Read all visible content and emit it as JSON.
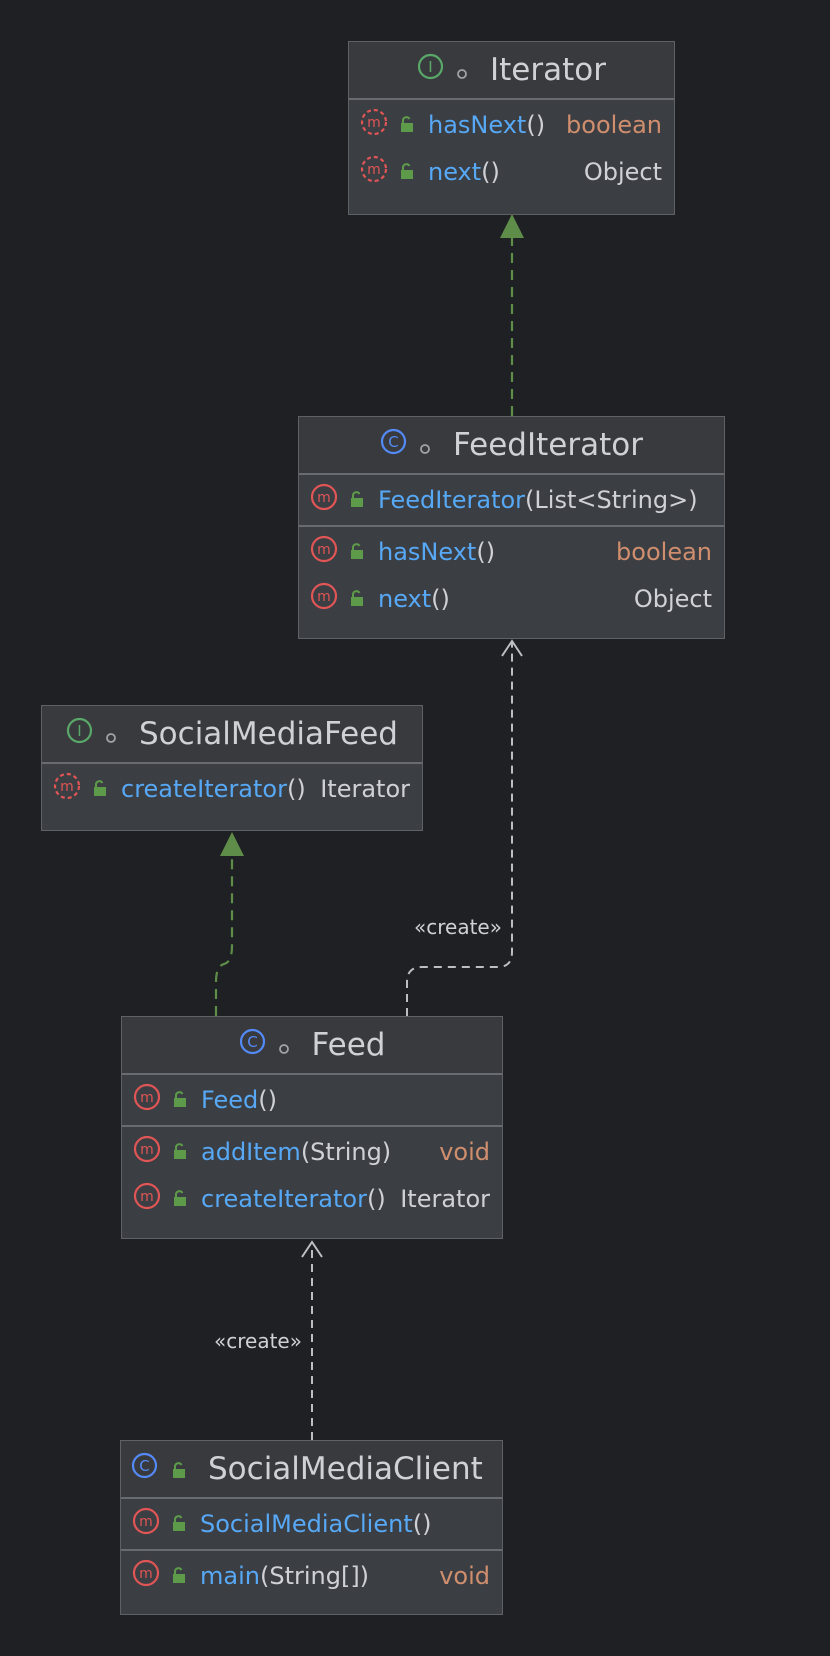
{
  "colors": {
    "background": "#1f2023",
    "box": "#3b3e43",
    "header": "#393a3d",
    "method_name": "#57a8f5",
    "primitive_type": "#cf8e6d",
    "realization_edge": "#5d8d49",
    "dependency_edge": "#bcbec4",
    "interface_icon": "#59a869",
    "class_icon": "#548af7",
    "method_icon": "#e05555"
  },
  "boxes": {
    "iterator": {
      "name": "Iterator",
      "kind": "interface",
      "kind_letter": "I",
      "methods": [
        {
          "name": "hasNext",
          "params": "()",
          "type": "boolean",
          "abstract": true,
          "primitive": true
        },
        {
          "name": "next",
          "params": "()",
          "type": "Object",
          "abstract": true,
          "primitive": false
        }
      ]
    },
    "feed_iterator": {
      "name": "FeedIterator",
      "kind": "class",
      "kind_letter": "C",
      "constructors": [
        {
          "name": "FeedIterator",
          "params": "(List<String>)"
        }
      ],
      "methods": [
        {
          "name": "hasNext",
          "params": "()",
          "type": "boolean",
          "primitive": true
        },
        {
          "name": "next",
          "params": "()",
          "type": "Object",
          "primitive": false
        }
      ]
    },
    "social_media_feed": {
      "name": "SocialMediaFeed",
      "kind": "interface",
      "kind_letter": "I",
      "methods": [
        {
          "name": "createIterator",
          "params": "()",
          "type": "Iterator",
          "abstract": true,
          "primitive": false
        }
      ]
    },
    "feed": {
      "name": "Feed",
      "kind": "class",
      "kind_letter": "C",
      "constructors": [
        {
          "name": "Feed",
          "params": "()"
        }
      ],
      "methods": [
        {
          "name": "addItem",
          "params": "(String)",
          "type": "void",
          "primitive": true
        },
        {
          "name": "createIterator",
          "params": "()",
          "type": "Iterator",
          "primitive": false
        }
      ]
    },
    "social_media_client": {
      "name": "SocialMediaClient",
      "kind": "class",
      "kind_letter": "C",
      "constructors": [
        {
          "name": "SocialMediaClient",
          "params": "()"
        }
      ],
      "methods": [
        {
          "name": "main",
          "params": "(String[])",
          "type": "void",
          "primitive": true
        }
      ]
    }
  },
  "edges": {
    "feed_to_iterator_label": "«create»",
    "client_to_feed_label": "«create»"
  }
}
